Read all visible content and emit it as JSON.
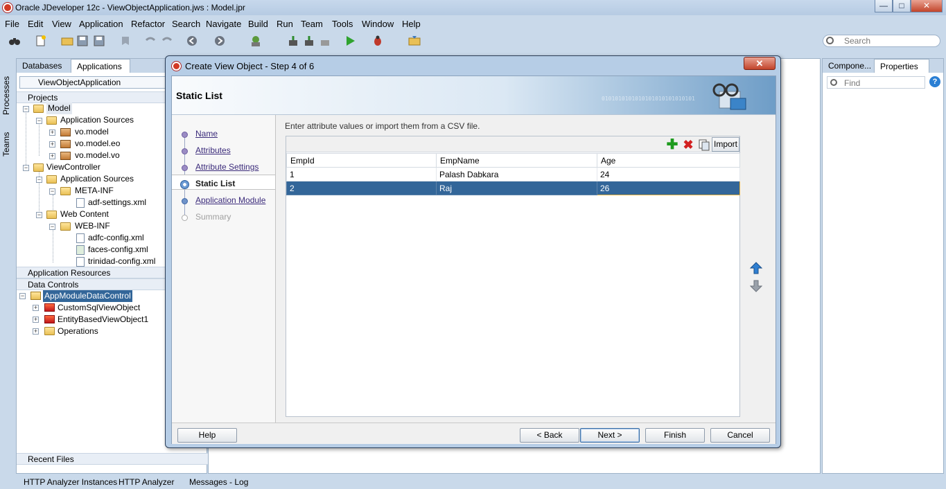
{
  "window": {
    "title": "Oracle JDeveloper 12c - ViewObjectApplication.jws : Model.jpr",
    "minimize": "—",
    "maximize": "□",
    "close": "✕"
  },
  "menu": [
    "File",
    "Edit",
    "View",
    "Application",
    "Refactor",
    "Search",
    "Navigate",
    "Build",
    "Run",
    "Team",
    "Tools",
    "Window",
    "Help"
  ],
  "toolbar": {
    "search_placeholder": "Search"
  },
  "left_strip": {
    "tabs": [
      "Processes",
      "Teams"
    ]
  },
  "left_panel": {
    "tabs": [
      "Databases",
      "Applications"
    ],
    "app_selector": "ViewObjectApplication",
    "projects_header": "Projects",
    "tree": [
      {
        "label": "Model"
      },
      {
        "label": "Application Sources"
      },
      {
        "label": "vo.model"
      },
      {
        "label": "vo.model.eo"
      },
      {
        "label": "vo.model.vo"
      },
      {
        "label": "ViewController"
      },
      {
        "label": "Application Sources"
      },
      {
        "label": "META-INF"
      },
      {
        "label": "adf-settings.xml"
      },
      {
        "label": "Web Content"
      },
      {
        "label": "WEB-INF"
      },
      {
        "label": "adfc-config.xml"
      },
      {
        "label": "faces-config.xml"
      },
      {
        "label": "trinidad-config.xml"
      }
    ],
    "app_resources_header": "Application Resources",
    "data_controls_header": "Data Controls",
    "data_controls": [
      {
        "label": "AppModuleDataControl"
      },
      {
        "label": "CustomSqlViewObject"
      },
      {
        "label": "EntityBasedViewObject1"
      },
      {
        "label": "Operations"
      }
    ],
    "recent_files_header": "Recent Files"
  },
  "right_panel": {
    "tabs": [
      "Compone...",
      "Properties"
    ],
    "find_placeholder": "Find"
  },
  "status_bar": [
    "HTTP Analyzer Instances",
    "HTTP Analyzer",
    "Messages - Log"
  ],
  "dialog": {
    "title": "Create View Object - Step 4 of 6",
    "header_title": "Static List",
    "binary_text": "0101010101010101010101010101",
    "steps": [
      {
        "label": "Name",
        "state": "link"
      },
      {
        "label": "Attributes",
        "state": "link"
      },
      {
        "label": "Attribute Settings",
        "state": "link"
      },
      {
        "label": "Static List",
        "state": "active"
      },
      {
        "label": "Application Module",
        "state": "link"
      },
      {
        "label": "Summary",
        "state": "disabled"
      }
    ],
    "instruction": "Enter attribute values or import them from a CSV file.",
    "import_label": "Import",
    "columns": [
      "EmpId",
      "EmpName",
      "Age"
    ],
    "rows": [
      {
        "EmpId": "1",
        "EmpName": "Palash Dabkara",
        "Age": "24"
      },
      {
        "EmpId": "2",
        "EmpName": "Raj",
        "Age": "26"
      }
    ],
    "buttons": {
      "help": "Help",
      "back": "< Back",
      "next": "Next >",
      "finish": "Finish",
      "cancel": "Cancel"
    }
  }
}
